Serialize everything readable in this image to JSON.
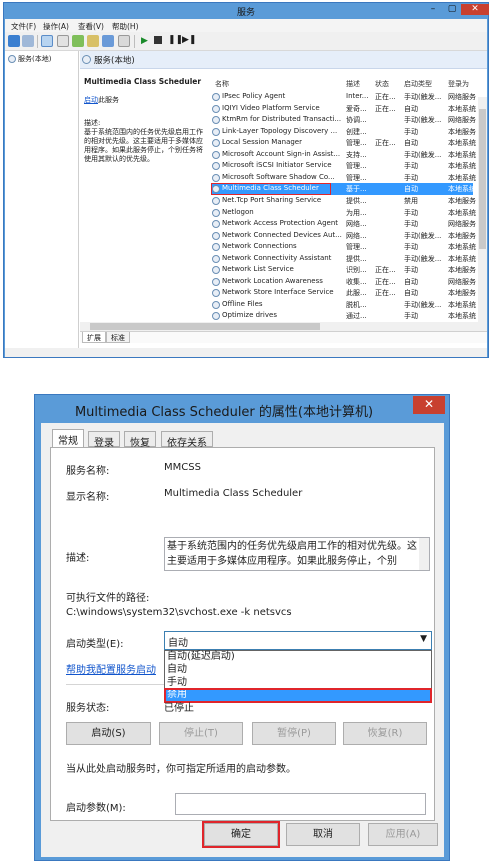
{
  "services_window": {
    "title": "服务",
    "menu": [
      "文件(F)",
      "操作(A)",
      "查看(V)",
      "帮助(H)"
    ],
    "tree_item": "服务(本地)",
    "header": "服务(本地)",
    "detail": {
      "name": "Multimedia Class Scheduler",
      "action_link": "启动",
      "action_suffix": "此服务",
      "desc_label": "描述:",
      "desc_text": "基于系统范围内的任务优先级启用工作的相对优先级。这主要适用于多媒体应用程序。如果此服务停止，个别任务将使用其默认的优先级。"
    },
    "columns": [
      "名称",
      "描述",
      "状态",
      "启动类型",
      "登录为"
    ],
    "rows": [
      {
        "name": "IPsec Policy Agent",
        "desc": "Inter...",
        "status": "正在...",
        "startup": "手动(触发...",
        "logon": "网络服务"
      },
      {
        "name": "IQIYI Video Platform Service",
        "desc": "爱奇...",
        "status": "正在...",
        "startup": "自动",
        "logon": "本地系统"
      },
      {
        "name": "KtmRm for Distributed Transacti...",
        "desc": "协调...",
        "status": "",
        "startup": "手动(触发...",
        "logon": "网络服务"
      },
      {
        "name": "Link-Layer Topology Discovery ...",
        "desc": "创建...",
        "status": "",
        "startup": "手动",
        "logon": "本地服务"
      },
      {
        "name": "Local Session Manager",
        "desc": "管理...",
        "status": "正在...",
        "startup": "自动",
        "logon": "本地系统"
      },
      {
        "name": "Microsoft Account Sign-in Assist...",
        "desc": "支持...",
        "status": "",
        "startup": "手动(触发...",
        "logon": "本地系统"
      },
      {
        "name": "Microsoft iSCSI Initiator Service",
        "desc": "管理...",
        "status": "",
        "startup": "手动",
        "logon": "本地系统"
      },
      {
        "name": "Microsoft Software Shadow Co...",
        "desc": "管理...",
        "status": "",
        "startup": "手动",
        "logon": "本地系统"
      },
      {
        "name": "Multimedia Class Scheduler",
        "desc": "基于...",
        "status": "",
        "startup": "自动",
        "logon": "本地系统"
      },
      {
        "name": "Net.Tcp Port Sharing Service",
        "desc": "提供...",
        "status": "",
        "startup": "禁用",
        "logon": "本地服务"
      },
      {
        "name": "Netlogon",
        "desc": "为用...",
        "status": "",
        "startup": "手动",
        "logon": "本地系统"
      },
      {
        "name": "Network Access Protection Agent",
        "desc": "网络...",
        "status": "",
        "startup": "手动",
        "logon": "网络服务"
      },
      {
        "name": "Network Connected Devices Aut...",
        "desc": "网络...",
        "status": "",
        "startup": "手动(触发...",
        "logon": "本地服务"
      },
      {
        "name": "Network Connections",
        "desc": "管理...",
        "status": "",
        "startup": "手动",
        "logon": "本地系统"
      },
      {
        "name": "Network Connectivity Assistant",
        "desc": "提供...",
        "status": "",
        "startup": "手动(触发...",
        "logon": "本地系统"
      },
      {
        "name": "Network List Service",
        "desc": "识别...",
        "status": "正在...",
        "startup": "手动",
        "logon": "本地服务"
      },
      {
        "name": "Network Location Awareness",
        "desc": "收集...",
        "status": "正在...",
        "startup": "自动",
        "logon": "网络服务"
      },
      {
        "name": "Network Store Interface Service",
        "desc": "此服...",
        "status": "正在...",
        "startup": "自动",
        "logon": "本地服务"
      },
      {
        "name": "Offline Files",
        "desc": "脱机...",
        "status": "",
        "startup": "手动(触发...",
        "logon": "本地系统"
      },
      {
        "name": "Optimize drives",
        "desc": "通过...",
        "status": "",
        "startup": "手动",
        "logon": "本地系统"
      }
    ],
    "tabs": [
      "扩展",
      "标准"
    ]
  },
  "dialog": {
    "title": "Multimedia Class Scheduler 的属性(本地计算机)",
    "close": "✕",
    "tabs": [
      "常规",
      "登录",
      "恢复",
      "依存关系"
    ],
    "service_name_label": "服务名称:",
    "service_name": "MMCSS",
    "display_name_label": "显示名称:",
    "display_name": "Multimedia Class Scheduler",
    "desc_label": "描述:",
    "desc_text": "基于系统范围内的任务优先级启用工作的相对优先级。这主要适用于多媒体应用程序。如果此服务停止，个别",
    "path_label": "可执行文件的路径:",
    "path": "C:\\windows\\system32\\svchost.exe -k netsvcs",
    "startup_label": "启动类型(E):",
    "startup_value": "自动",
    "startup_options": [
      "自动(延迟启动)",
      "自动",
      "手动",
      "禁用"
    ],
    "help_link": "帮助我配置服务启动",
    "status_label": "服务状态:",
    "status_value": "已停止",
    "btn_start": "启动(S)",
    "btn_stop": "停止(T)",
    "btn_pause": "暂停(P)",
    "btn_resume": "恢复(R)",
    "hint": "当从此处启动服务时，你可指定所适用的启动参数。",
    "param_label": "启动参数(M):",
    "btn_ok": "确定",
    "btn_cancel": "取消",
    "btn_apply": "应用(A)"
  },
  "colors": {
    "selection": "#3399ff",
    "highlight_border": "#e0252b",
    "window_frame": "#5a9bd8"
  }
}
